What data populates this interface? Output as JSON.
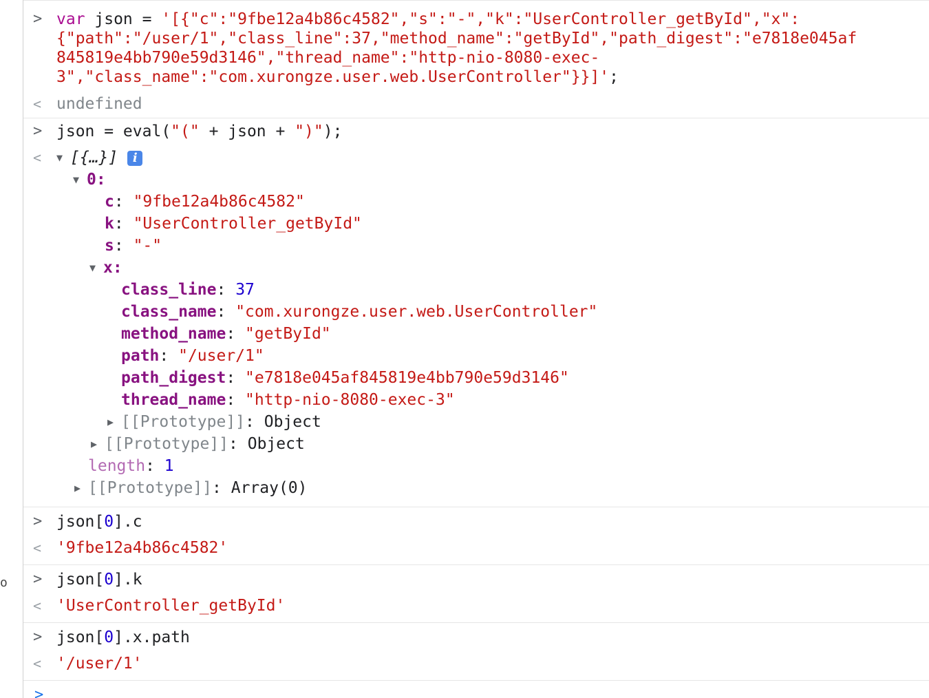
{
  "prompt_symbol": ">",
  "result_symbol": "<",
  "gutter_mark": "o",
  "entry1": {
    "line1": {
      "kw": "var",
      "plain": " json = ",
      "str": "'[{\"c\":\"9fbe12a4b86c4582\",\"s\":\"-\",\"k\":\"UserController_getById\",\"x\":"
    },
    "line2": "{\"path\":\"/user/1\",\"class_line\":37,\"method_name\":\"getById\",\"path_digest\":\"e7818e045af",
    "line3": "845819e4bb790e59d3146\",\"thread_name\":\"http-nio-8080-exec-",
    "line4": {
      "str": "3\",\"class_name\":\"com.xurongze.user.web.UserController\"}}]'",
      "plain": ";"
    },
    "result": "undefined"
  },
  "entry2": {
    "input": {
      "a": "json = eval(",
      "s1": "\"(\"",
      "b": " + json + ",
      "s2": "\")\"",
      "c": ");"
    },
    "summary": "[{…}]",
    "info_icon": "i",
    "tree": {
      "idx0": "0",
      "c": {
        "key": "c",
        "val": "\"9fbe12a4b86c4582\""
      },
      "k": {
        "key": "k",
        "val": "\"UserController_getById\""
      },
      "s": {
        "key": "s",
        "val": "\"-\""
      },
      "x": {
        "key": "x"
      },
      "class_line": {
        "key": "class_line",
        "val": "37"
      },
      "class_name": {
        "key": "class_name",
        "val": "\"com.xurongze.user.web.UserController\""
      },
      "method_name": {
        "key": "method_name",
        "val": "\"getById\""
      },
      "path": {
        "key": "path",
        "val": "\"/user/1\""
      },
      "path_digest": {
        "key": "path_digest",
        "val": "\"e7818e045af845819e4bb790e59d3146\""
      },
      "thread_name": {
        "key": "thread_name",
        "val": "\"http-nio-8080-exec-3\""
      },
      "proto_x": {
        "key": "[[Prototype]]",
        "val": "Object"
      },
      "proto_0": {
        "key": "[[Prototype]]",
        "val": "Object"
      },
      "length": {
        "key": "length",
        "val": "1"
      },
      "proto_arr": {
        "key": "[[Prototype]]",
        "val": "Array(0)"
      }
    }
  },
  "entry3": {
    "input": {
      "a": "json[",
      "n": "0",
      "b": "].c"
    },
    "result": "'9fbe12a4b86c4582'"
  },
  "entry4": {
    "input": {
      "a": "json[",
      "n": "0",
      "b": "].k"
    },
    "result": "'UserController_getById'"
  },
  "entry5": {
    "input": {
      "a": "json[",
      "n": "0",
      "b": "].x.path"
    },
    "result": "'/user/1'"
  }
}
